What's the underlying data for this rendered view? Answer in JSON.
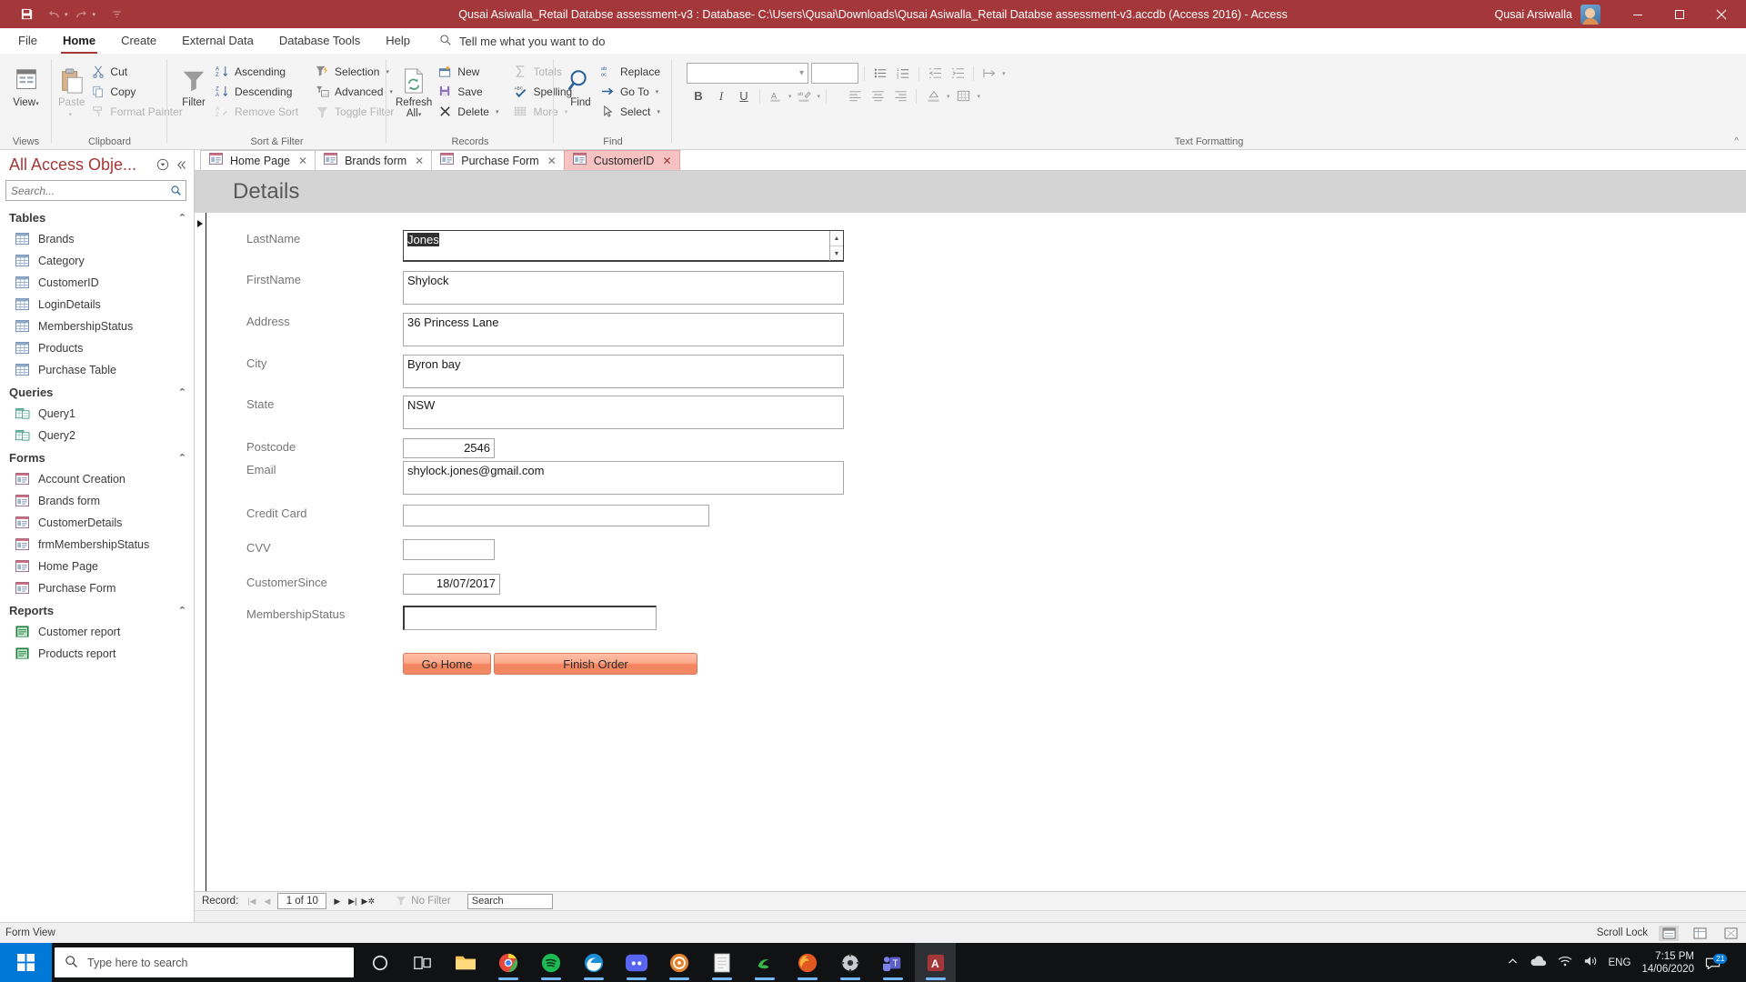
{
  "titlebar": {
    "document_title": "Qusai Asiwalla_Retail Databse assessment-v3 : Database- C:\\Users\\Qusai\\Downloads\\Qusai Asiwalla_Retail Databse assessment-v3.accdb (Access 2016)  -  Access",
    "account_name": "Qusai Arsiwalla",
    "qat": {
      "save": "Save",
      "undo": "Undo",
      "redo": "Redo",
      "customize": "Customize Quick Access Toolbar"
    },
    "window": {
      "minimize": "Minimize",
      "restore": "Restore Down",
      "close": "Close"
    },
    "accent": "#a4373a"
  },
  "menubar": {
    "items": [
      {
        "label": "File",
        "active": false
      },
      {
        "label": "Home",
        "active": true
      },
      {
        "label": "Create",
        "active": false
      },
      {
        "label": "External Data",
        "active": false
      },
      {
        "label": "Database Tools",
        "active": false
      },
      {
        "label": "Help",
        "active": false
      }
    ],
    "tellme": "Tell me what you want to do"
  },
  "ribbon": {
    "groups": [
      {
        "name": "Views"
      },
      {
        "name": "Clipboard"
      },
      {
        "name": "Sort & Filter"
      },
      {
        "name": "Records"
      },
      {
        "name": "Find"
      },
      {
        "name": "Text Formatting"
      }
    ],
    "views": {
      "button": "View"
    },
    "clipboard": {
      "paste": "Paste",
      "cut": "Cut",
      "copy": "Copy",
      "format_painter": "Format Painter"
    },
    "sortfilter": {
      "filter": "Filter",
      "ascending": "Ascending",
      "descending": "Descending",
      "remove_sort": "Remove Sort",
      "selection": "Selection",
      "advanced": "Advanced",
      "toggle_filter": "Toggle Filter"
    },
    "records": {
      "refresh_all_line1": "Refresh",
      "refresh_all_line2": "All",
      "new": "New",
      "save": "Save",
      "delete": "Delete",
      "totals": "Totals",
      "spelling": "Spelling",
      "more": "More"
    },
    "find": {
      "find": "Find",
      "replace": "Replace",
      "goto": "Go To",
      "select": "Select"
    },
    "textformatting": {
      "font_name": "",
      "font_size": "",
      "bold": "B",
      "italic": "I",
      "underline": "U",
      "font_color": "A",
      "highlight": "ab"
    }
  },
  "navpane": {
    "title": "All Access Obje...",
    "search_placeholder": "Search...",
    "search_value": "",
    "sections": [
      {
        "label": "Tables",
        "kind": "table",
        "items": [
          "Brands",
          "Category",
          "CustomerID",
          "LoginDetails",
          "MembershipStatus",
          "Products",
          "Purchase Table"
        ]
      },
      {
        "label": "Queries",
        "kind": "query",
        "items": [
          "Query1",
          "Query2"
        ]
      },
      {
        "label": "Forms",
        "kind": "form",
        "items": [
          "Account Creation",
          "Brands form",
          "CustomerDetails",
          "frmMembershipStatus",
          "Home Page",
          "Purchase Form"
        ]
      },
      {
        "label": "Reports",
        "kind": "report",
        "items": [
          "Customer report",
          "Products report"
        ]
      }
    ]
  },
  "doctabs": [
    {
      "label": "Home Page",
      "active": false
    },
    {
      "label": "Brands form",
      "active": false
    },
    {
      "label": "Purchase Form",
      "active": false
    },
    {
      "label": "CustomerID",
      "active": true
    }
  ],
  "form": {
    "header_title": "Details",
    "fields": [
      {
        "label": "LastName",
        "value": "Jones",
        "name": "lastname"
      },
      {
        "label": "FirstName",
        "value": "Shylock",
        "name": "firstname"
      },
      {
        "label": "Address",
        "value": "36 Princess Lane",
        "name": "address"
      },
      {
        "label": "City",
        "value": "Byron bay",
        "name": "city"
      },
      {
        "label": "State",
        "value": "NSW",
        "name": "state"
      },
      {
        "label": "Postcode",
        "value": "2546",
        "name": "postcode"
      },
      {
        "label": "Email",
        "value": "shylock.jones@gmail.com",
        "name": "email"
      },
      {
        "label": "Credit Card",
        "value": "",
        "name": "credit-card"
      },
      {
        "label": " CVV",
        "value": "",
        "name": "cvv"
      },
      {
        "label": "CustomerSince",
        "value": "18/07/2017",
        "name": "customer-since"
      },
      {
        "label": "MembershipStatus",
        "value": "",
        "name": "membership-status"
      }
    ],
    "buttons": [
      {
        "label": "Go Home",
        "name": "go-home"
      },
      {
        "label": "Finish Order",
        "name": "finish-order"
      }
    ],
    "button_color": "#f4845f"
  },
  "recordnav": {
    "label": "Record:",
    "position": "1 of 10",
    "filter_status": "No Filter",
    "search_placeholder": "Search",
    "search_value": "Search"
  },
  "statusbar": {
    "view_mode": "Form View",
    "scroll_lock": "Scroll Lock"
  },
  "taskbar": {
    "search_placeholder": "Type here to search",
    "language": "ENG",
    "time": "7:15 PM",
    "date": "14/06/2020",
    "notification_count": "21"
  }
}
